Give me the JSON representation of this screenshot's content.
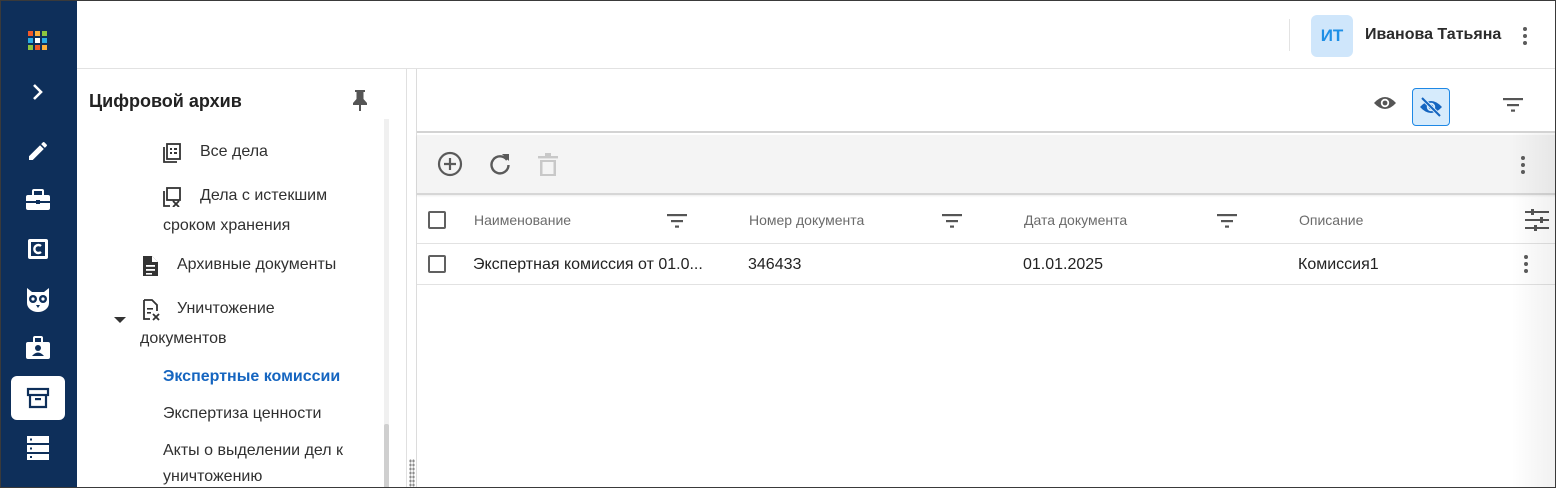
{
  "user": {
    "initials": "ИТ",
    "name": "Иванова Татьяна"
  },
  "rail": {
    "items": [
      "apps-grid",
      "expand-chevron",
      "edit-pencil",
      "briefcase-case",
      "c-box",
      "owl",
      "badge-case",
      "archive-box",
      "server-stack"
    ],
    "active": "archive-box"
  },
  "tree": {
    "title": "Цифровой архив",
    "nodes": [
      {
        "label_l1": "Все дела",
        "label_l2": ""
      },
      {
        "label_l1": "Дела с истекшим",
        "label_l2": "сроком хранения"
      },
      {
        "label_l1": "Архивные документы",
        "label_l2": ""
      },
      {
        "label_l1": "Уничтожение",
        "label_l2": "документов"
      },
      {
        "label_l1": "Экспертные комиссии",
        "label_l2": ""
      },
      {
        "label_l1": "Экспертиза ценности",
        "label_l2": ""
      },
      {
        "label_l1": "Акты о выделении дел к",
        "label_l2": "уничтожению"
      }
    ],
    "active_index": 4
  },
  "grid": {
    "columns": [
      "Наименование",
      "Номер документа",
      "Дата документа",
      "Описание"
    ],
    "rows": [
      {
        "name": "Экспертная комиссия от 01.0...",
        "number": "346433",
        "date": "01.01.2025",
        "description": "Комиссия1"
      }
    ]
  },
  "colors": {
    "rail_bg": "#0e2f5a",
    "accent": "#1565c0",
    "avatar_bg": "#cfe6fb"
  }
}
